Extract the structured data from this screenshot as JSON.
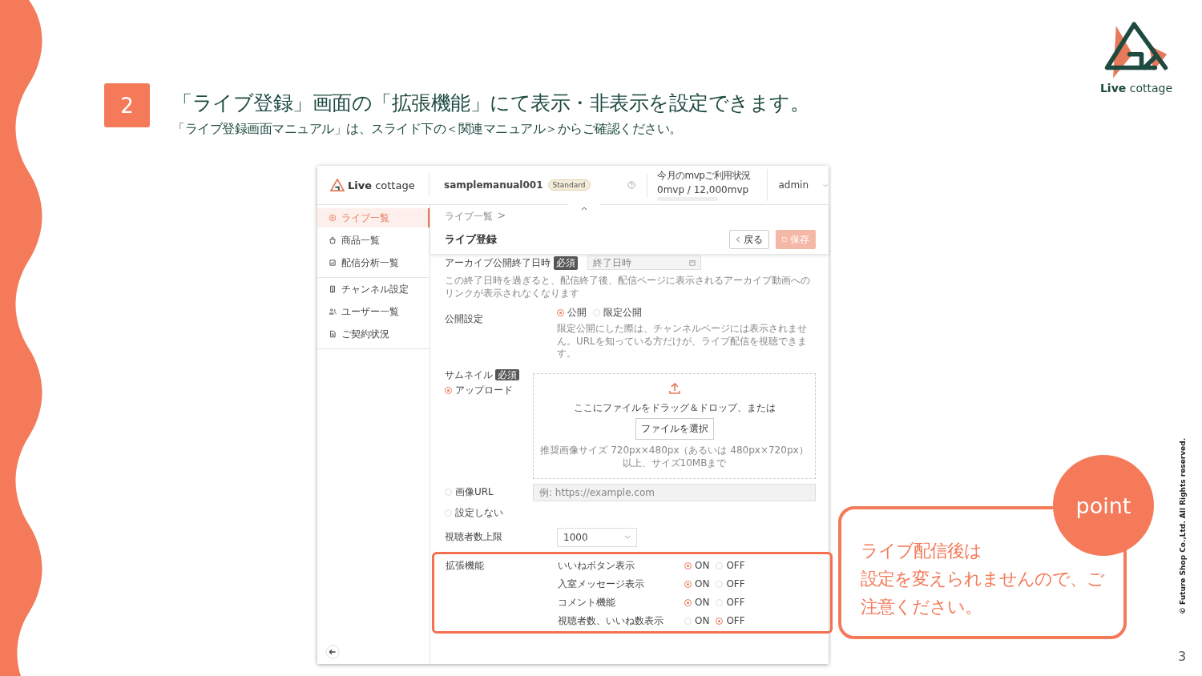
{
  "slide": {
    "step_number": "2",
    "title": "「ライブ登録」画面の「拡張機能」にて表示・非表示を設定できます。",
    "subtitle": "「ライブ登録画面マニュアル」は、スライド下の＜関連マニュアル＞からご確認ください。",
    "logo_text": "**Live** cottage",
    "point_label": "point",
    "point_text": [
      "ライブ配信後は",
      "設定を変えられませんので、ご注意ください。"
    ],
    "copyright": "© Future Shop Co.,Ltd. All Rights reserved.",
    "page_number": "3"
  },
  "app": {
    "header": {
      "brand": "**Live** cottage",
      "account": "samplemanual001",
      "plan": "Standard",
      "usage_title": "今月のmvpご利用状況",
      "usage": "0mvp / 12,000mvp",
      "user": "admin"
    },
    "sidebar": {
      "groups": [
        [
          {
            "label": "ライブ一覧",
            "selected": true
          },
          {
            "label": "商品一覧",
            "selected": false
          },
          {
            "label": "配信分析一覧",
            "selected": false
          }
        ],
        [
          {
            "label": "チャンネル設定",
            "selected": false
          },
          {
            "label": "ユーザー一覧",
            "selected": false
          },
          {
            "label": "ご契約状況",
            "selected": false
          }
        ]
      ]
    },
    "page": {
      "breadcrumb": "ライブ一覧",
      "breadcrumb_separator": ">",
      "title": "ライブ登録",
      "back_button": "戻る",
      "save_button": {
        "label": "保存",
        "disabled": true
      }
    },
    "form": {
      "archive_end": {
        "label": "アーカイブ公開終了日時",
        "badge": "必須",
        "placeholder": "終了日時",
        "note": "この終了日時を過ぎると、配信終了後、配信ページに表示されるアーカイブ動画へのリンクが表示されなくなります"
      },
      "visibility": {
        "label": "公開設定",
        "options": [
          {
            "label": "公開",
            "selected": true
          },
          {
            "label": "限定公開",
            "selected": false
          }
        ],
        "note": "限定公開にした際は、チャンネルページには表示されません。URLを知っている方だけが、ライブ配信を視聴できます。"
      },
      "thumbnail": {
        "label": "サムネイル",
        "badge": "必須",
        "options": [
          {
            "label": "アップロード",
            "selected": true
          },
          {
            "label": "画像URL",
            "selected": false
          },
          {
            "label": "設定しない",
            "selected": false
          }
        ],
        "drop_text": "ここにファイルをドラッグ＆ドロップ、または",
        "choose_button": "ファイルを選択",
        "hint": "推奨画像サイズ 720px×480px（あるいは 480px×720px）以上、サイズ10MBまで",
        "url_placeholder": "例: https://example.com"
      },
      "viewer_limit": {
        "label": "視聴者数上限",
        "value": "1000"
      },
      "extensions": {
        "label": "拡張機能",
        "highlighted": true,
        "items": [
          {
            "label": "いいねボタン表示",
            "choices": [
              {
                "label": "ON",
                "selected": true
              },
              {
                "label": "OFF",
                "selected": false
              }
            ]
          },
          {
            "label": "入室メッセージ表示",
            "choices": [
              {
                "label": "ON",
                "selected": true
              },
              {
                "label": "OFF",
                "selected": false
              }
            ]
          },
          {
            "label": "コメント機能",
            "choices": [
              {
                "label": "ON",
                "selected": true
              },
              {
                "label": "OFF",
                "selected": false
              }
            ]
          },
          {
            "label": "視聴者数、いいね数表示",
            "choices": [
              {
                "label": "ON",
                "selected": false
              },
              {
                "label": "OFF",
                "selected": true
              }
            ]
          }
        ]
      }
    }
  }
}
